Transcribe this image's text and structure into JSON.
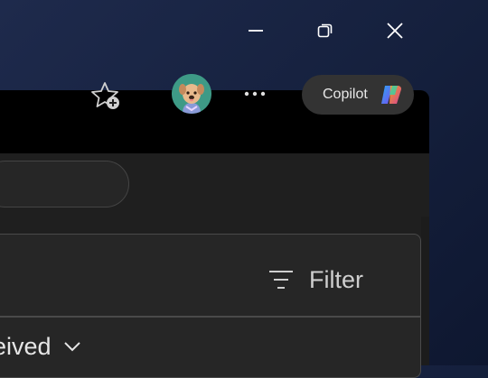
{
  "window": {
    "caption": {
      "minimize_icon": "minimize-icon",
      "maximize_icon": "restore-icon",
      "close_icon": "close-icon"
    }
  },
  "toolbar": {
    "favorites_icon": "star-add-icon",
    "more_icon": "more-horizontal-icon",
    "copilot_label": "Copilot"
  },
  "panel": {
    "filter_label": "Filter",
    "received_label": "eived"
  },
  "colors": {
    "desktop_bg": "#1a2446",
    "titlebar": "#000000",
    "toolbar": "#1f1f1f",
    "avatar_bg": "#3e9a86"
  }
}
